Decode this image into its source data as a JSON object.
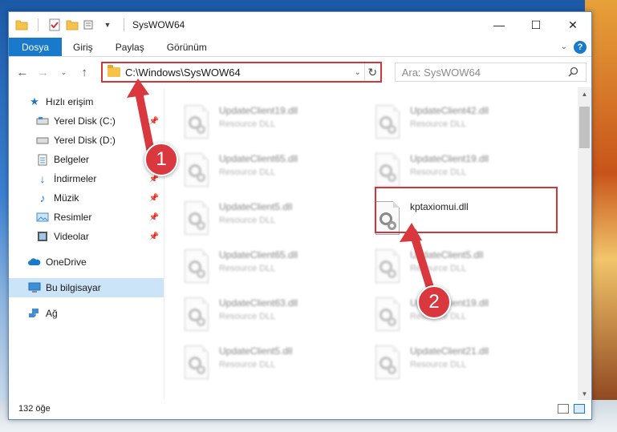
{
  "window": {
    "title": "SysWOW64"
  },
  "ribbon": {
    "tabs": [
      "Dosya",
      "Giriş",
      "Paylaş",
      "Görünüm"
    ],
    "active_tab": "Dosya"
  },
  "address_bar": {
    "path": "C:\\Windows\\SysWOW64"
  },
  "search": {
    "placeholder": "Ara: SysWOW64"
  },
  "sidebar": {
    "quick_access": "Hızlı erişim",
    "quick_items": [
      {
        "label": "Yerel Disk (C:)",
        "icon": "drive-icon",
        "pinned": true
      },
      {
        "label": "Yerel Disk (D:)",
        "icon": "drive-icon",
        "pinned": false
      },
      {
        "label": "Belgeler",
        "icon": "documents-icon",
        "pinned": true
      },
      {
        "label": "İndirmeler",
        "icon": "download-icon",
        "pinned": true
      },
      {
        "label": "Müzik",
        "icon": "music-icon",
        "pinned": true
      },
      {
        "label": "Resimler",
        "icon": "pictures-icon",
        "pinned": true
      },
      {
        "label": "Videolar",
        "icon": "videos-icon",
        "pinned": true
      }
    ],
    "onedrive": "OneDrive",
    "this_pc": "Bu bilgisayar",
    "network": "Ağ"
  },
  "files": [
    {
      "name": "UpdateClient19.dll",
      "type": "Resource DLL",
      "blurred": true
    },
    {
      "name": "UpdateClient42.dll",
      "type": "Resource DLL",
      "blurred": true
    },
    {
      "name": "UpdateClient65.dll",
      "type": "Resource DLL",
      "blurred": true
    },
    {
      "name": "UpdateClient19.dll",
      "type": "Resource DLL",
      "blurred": true
    },
    {
      "name": "UpdateClient5.dll",
      "type": "Resource DLL",
      "blurred": true
    },
    {
      "name": "kptaxiomui.dll",
      "type": "",
      "blurred": false
    },
    {
      "name": "UpdateClient65.dll",
      "type": "Resource DLL",
      "blurred": true
    },
    {
      "name": "UpdateClient5.dll",
      "type": "Resource DLL",
      "blurred": true
    },
    {
      "name": "UpdateClient63.dll",
      "type": "Resource DLL",
      "blurred": true
    },
    {
      "name": "UpdateClient19.dll",
      "type": "Resource DLL",
      "blurred": true
    },
    {
      "name": "UpdateClient5.dll",
      "type": "Resource DLL",
      "blurred": true
    },
    {
      "name": "UpdateClient21.dll",
      "type": "Resource DLL",
      "blurred": true
    }
  ],
  "status": {
    "item_count": "132 öğe"
  },
  "callouts": {
    "one": "1",
    "two": "2"
  },
  "colors": {
    "accent": "#1979ca",
    "highlight": "#d1363a",
    "callout": "#d9383e"
  }
}
